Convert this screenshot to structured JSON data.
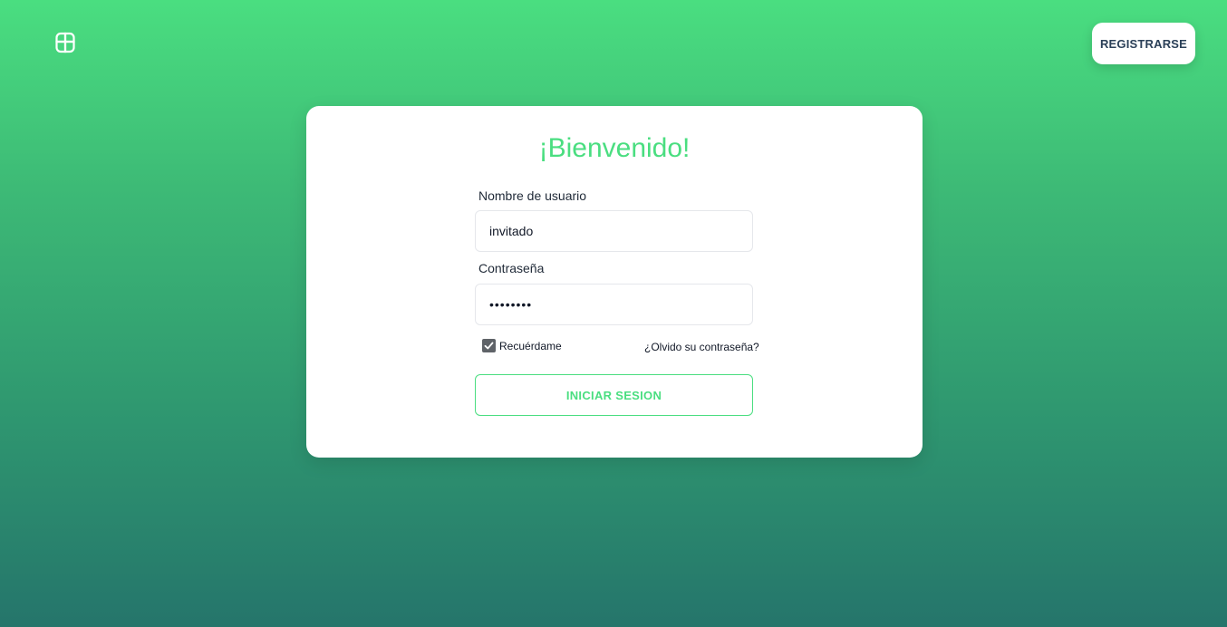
{
  "header": {
    "logo_icon": "app-logo-icon",
    "register_label": "REGISTRARSE"
  },
  "login_card": {
    "title": "¡Bienvenido!",
    "username_label": "Nombre de usuario",
    "username_value": "invitado",
    "password_label": "Contraseña",
    "password_value": "••••••••",
    "remember_label": "Recuérdame",
    "remember_checked": true,
    "forgot_label": "¿Olvido su contraseña?",
    "submit_label": "INICIAR SESION"
  },
  "colors": {
    "accent": "#4ade80",
    "background_top": "#4ade80",
    "background_bottom": "#25756b",
    "register_text": "#2b4058"
  }
}
